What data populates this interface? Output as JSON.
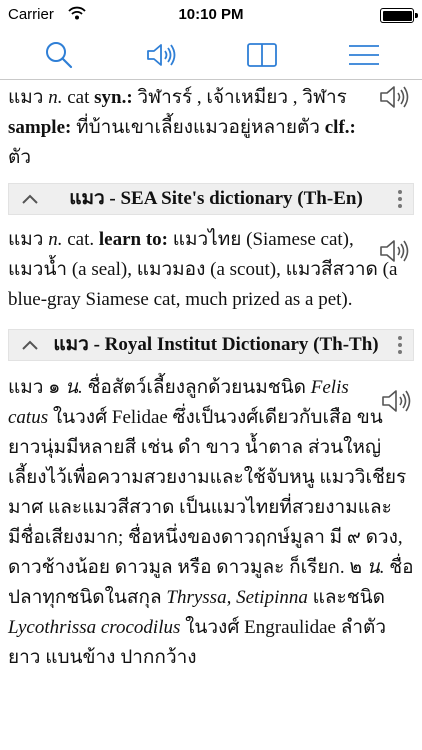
{
  "status_bar": {
    "carrier": "Carrier",
    "time": "10:10 PM"
  },
  "toolbar": {
    "accent_color": "#2f7fd6",
    "icons": [
      "search-icon",
      "speaker-icon",
      "book-icon",
      "menu-icon"
    ]
  },
  "entries": {
    "e1": {
      "word": "แมว",
      "pos": "n.",
      "meaning": "cat",
      "syn_label": "syn.:",
      "syn_text": "วิฬารร์ , เจ้าเหมียว , วิฬาร",
      "sample_label": "sample:",
      "sample_text": "ที่บ้านเขาเลี้ยงแมวอยู่หลายตัว",
      "clf_label": "clf.:",
      "clf_text": "ตัว"
    },
    "s2": {
      "title": "แมว - SEA Site's dictionary (Th-En)"
    },
    "e2": {
      "word": "แมว",
      "pos": "n.",
      "meaning": "cat.",
      "learn_label": "learn to:",
      "learn_text": "แมวไทย (Siamese cat), แมวน้ำ (a seal), แมวมอง (a scout), แมวสีสวาด (a blue-gray Siamese cat, much prized as a pet)."
    },
    "s3": {
      "title": "แมว - Royal Institut Dictionary (Th-Th)"
    },
    "e3": {
      "word": "แมว",
      "num1": "๑",
      "pos1": "น.",
      "text1": "ชื่อสัตว์เลี้ยงลูกด้วยนมชนิด",
      "sci1": "Felis catus",
      "text2": "ในวงศ์ Felidae ซึ่งเป็นวงศ์เดียวกับเสือ ขนยาวนุ่มมีหลายสี เช่น ดำ ขาว น้ำตาล ส่วนใหญ่เลี้ยงไว้เพื่อความสวยงามและใช้จับหนู แมววิเชียรมาศ และแมวสีสวาด เป็นแมวไทยที่สวยงามและมีชื่อเสียงมาก; ชื่อหนึ่งของดาวฤกษ์มูลา มี ๙ ดวง, ดาวช้างน้อย ดาวมูล หรือ ดาวมูละ ก็เรียก.",
      "num2": "๒",
      "pos2": "น.",
      "text3": "ชื่อปลาทุกชนิดในสกุล",
      "sci2": "Thryssa, Setipinna",
      "text4": "และชนิด",
      "sci3": "Lycothrissa crocodilus",
      "text5": "ในวงศ์ Engraulidae ลำตัวยาว แบนข้าง ปากกว้าง"
    }
  }
}
